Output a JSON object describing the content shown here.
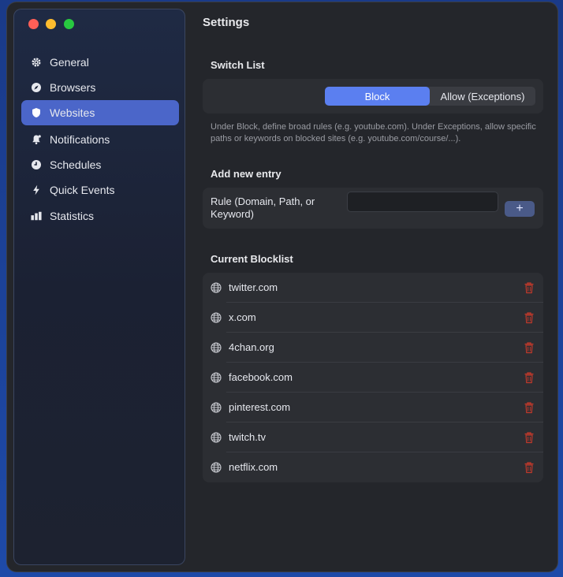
{
  "window": {
    "title": "Settings"
  },
  "sidebar": {
    "items": [
      {
        "label": "General",
        "icon": "gear-icon"
      },
      {
        "label": "Browsers",
        "icon": "compass-icon"
      },
      {
        "label": "Websites",
        "icon": "shield-icon",
        "active": true
      },
      {
        "label": "Notifications",
        "icon": "bell-icon"
      },
      {
        "label": "Schedules",
        "icon": "clock-icon"
      },
      {
        "label": "Quick Events",
        "icon": "bolt-icon"
      },
      {
        "label": "Statistics",
        "icon": "bar-chart-icon"
      }
    ]
  },
  "switch_list": {
    "heading": "Switch List",
    "options": [
      "Block",
      "Allow (Exceptions)"
    ],
    "selected": "Block",
    "help": "Under Block, define broad rules (e.g. youtube.com). Under Exceptions, allow specific paths or keywords on blocked sites (e.g. youtube.com/course/...)."
  },
  "add_entry": {
    "heading": "Add new entry",
    "label": "Rule (Domain, Path, or Keyword)",
    "value": "",
    "add_label": "+"
  },
  "blocklist": {
    "heading": "Current Blocklist",
    "items": [
      "twitter.com",
      "x.com",
      "4chan.org",
      "facebook.com",
      "pinterest.com",
      "twitch.tv",
      "netflix.com"
    ]
  },
  "colors": {
    "accent": "#5b7ff0",
    "active_nav": "#4b66c9",
    "delete": "#c0392b"
  }
}
